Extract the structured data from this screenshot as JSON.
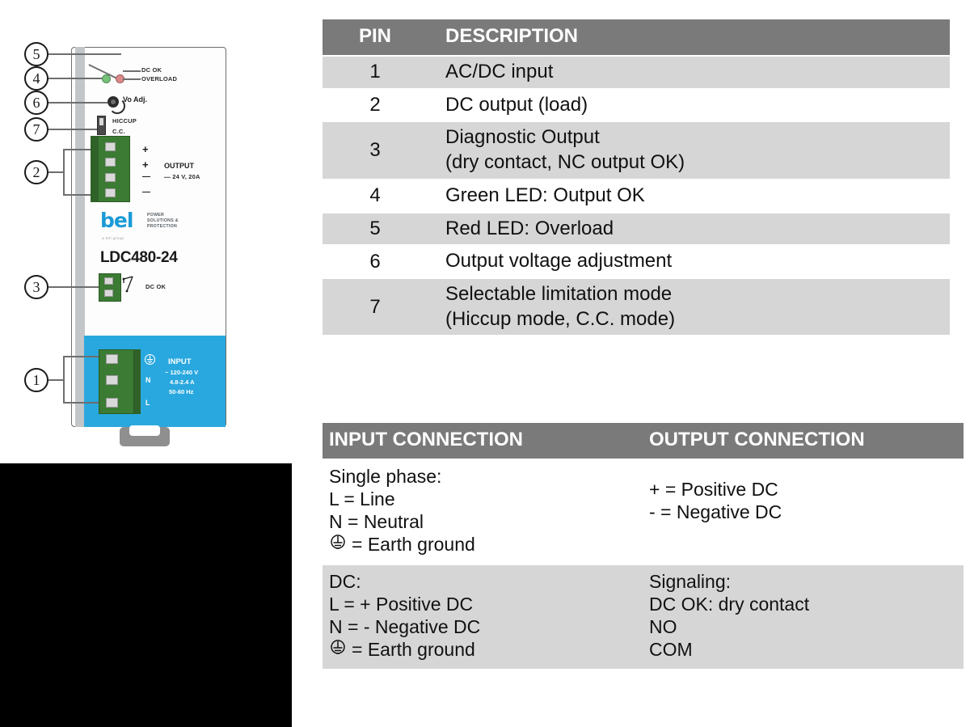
{
  "product_image": {
    "model_name": "LDC480-24",
    "brand": {
      "logo_text": "bel",
      "tagline_line1": "POWER",
      "tagline_line2": "SOLUTIONS &",
      "tagline_line3": "PROTECTION",
      "group_text": "a bel group"
    },
    "callouts": [
      {
        "number": "5",
        "target": "red-overload-led"
      },
      {
        "number": "4",
        "target": "green-dc-ok-led"
      },
      {
        "number": "6",
        "target": "output-voltage-potentiometer"
      },
      {
        "number": "7",
        "target": "hiccup-cc-selector-switch"
      },
      {
        "number": "2",
        "target": "dc-output-terminal-block"
      },
      {
        "number": "3",
        "target": "dc-ok-signal-terminal-block"
      },
      {
        "number": "1",
        "target": "ac-dc-input-terminal-block"
      }
    ],
    "labels": {
      "dc_ok": "DC OK",
      "overload": "OVERLOAD",
      "vo_adj": "Vo Adj.",
      "hiccup": "HICCUP",
      "cc": "C.C.",
      "output_title": "OUTPUT",
      "output_spec": "24 V, 20A",
      "output_pins": [
        "+",
        "+",
        "—",
        "—"
      ],
      "dc_ok_signal": "DC OK",
      "input_title": "INPUT",
      "input_voltage": "120-240 V",
      "input_current": "4.8-2.4 A",
      "input_frequency": "50-60 Hz",
      "input_pin_neutral": "N",
      "input_pin_line": "L"
    },
    "colors": {
      "brand_blue": "#1b9ad6",
      "housing_blue": "#29a8df",
      "terminal_green": "#3b7b33",
      "led_green": "#76c17a",
      "led_red": "#d98a8a"
    }
  },
  "pin_table": {
    "headers": {
      "pin": "PIN",
      "description": "DESCRIPTION"
    },
    "rows": [
      {
        "pin": "1",
        "description_line1": "AC/DC input",
        "description_line2": ""
      },
      {
        "pin": "2",
        "description_line1": "DC output (load)",
        "description_line2": ""
      },
      {
        "pin": "3",
        "description_line1": "Diagnostic Output",
        "description_line2": "(dry contact, NC output OK)"
      },
      {
        "pin": "4",
        "description_line1": "Green LED: Output OK",
        "description_line2": ""
      },
      {
        "pin": "5",
        "description_line1": "Red LED: Overload",
        "description_line2": ""
      },
      {
        "pin": "6",
        "description_line1": "Output voltage adjustment",
        "description_line2": ""
      },
      {
        "pin": "7",
        "description_line1": "Selectable limitation mode",
        "description_line2": "(Hiccup mode, C.C. mode)"
      }
    ]
  },
  "connection_table": {
    "headers": {
      "input": "INPUT CONNECTION",
      "output": "OUTPUT CONNECTION"
    },
    "row_ac": {
      "input_line1": "Single phase:",
      "input_line2": "L = Line",
      "input_line3": "N = Neutral",
      "input_line4": "= Earth ground",
      "output_line1": "+ = Positive DC",
      "output_line2": "-  = Negative DC"
    },
    "row_dc": {
      "input_line1": "DC:",
      "input_line2": "L = + Positive DC",
      "input_line3": "N = - Negative DC",
      "input_line4": "= Earth ground",
      "output_line1": "Signaling:",
      "output_line2": "DC OK: dry contact",
      "output_line3": "NO",
      "output_line4": "COM"
    }
  },
  "theme": {
    "header_gray": "#7a7a7a",
    "row_gray": "#d6d6d6",
    "text_black": "#111111"
  }
}
